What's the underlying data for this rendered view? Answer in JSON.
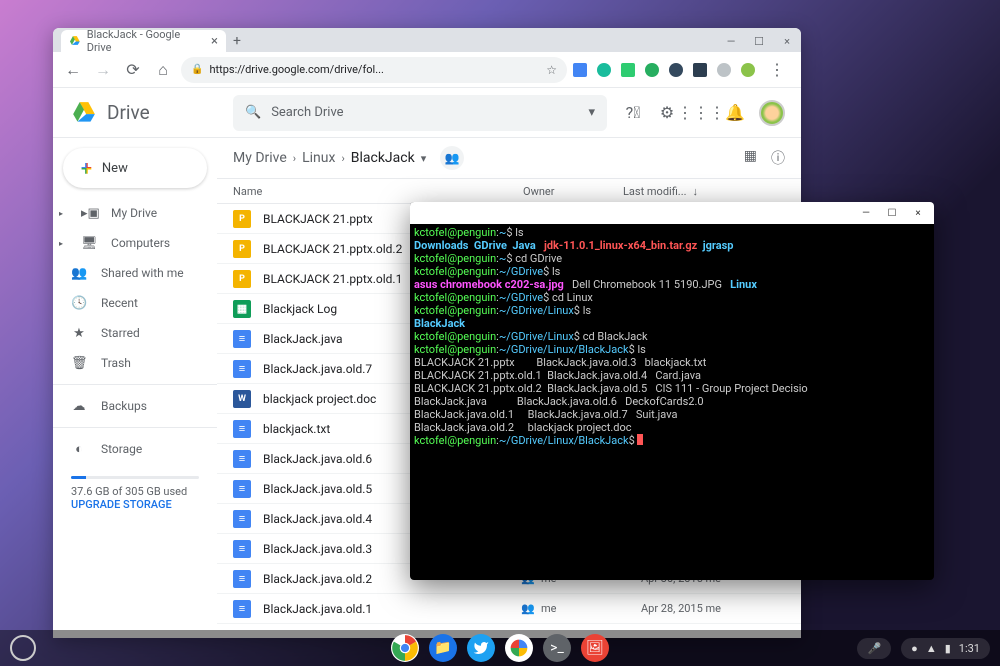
{
  "browser": {
    "tab_title": "BlackJack - Google Drive",
    "url": "https://drive.google.com/drive/fol...",
    "new_tab": "+"
  },
  "drive": {
    "app_name": "Drive",
    "search_placeholder": "Search Drive",
    "new_button": "New",
    "sidebar": [
      {
        "label": "My Drive",
        "icon": "▸▣",
        "exp": true
      },
      {
        "label": "Computers",
        "icon": "🖥",
        "exp": true
      },
      {
        "label": "Shared with me",
        "icon": "👥"
      },
      {
        "label": "Recent",
        "icon": "🕓"
      },
      {
        "label": "Starred",
        "icon": "★"
      },
      {
        "label": "Trash",
        "icon": "🗑"
      }
    ],
    "backups_label": "Backups",
    "storage_label": "Storage",
    "storage_used": "37.6 GB of 305 GB used",
    "upgrade": "UPGRADE STORAGE",
    "breadcrumb": [
      "My Drive",
      "Linux",
      "BlackJack"
    ],
    "columns": {
      "name": "Name",
      "owner": "Owner",
      "modified": "Last modifi..."
    },
    "files": [
      {
        "name": "BLACKJACK 21.pptx",
        "type": "slides",
        "shared": true
      },
      {
        "name": "BLACKJACK 21.pptx.old.2",
        "type": "slides",
        "shared": true
      },
      {
        "name": "BLACKJACK 21.pptx.old.1",
        "type": "slides",
        "shared": true
      },
      {
        "name": "Blackjack Log",
        "type": "sheets",
        "shared": true
      },
      {
        "name": "BlackJack.java",
        "type": "doc",
        "shared": true
      },
      {
        "name": "BlackJack.java.old.7",
        "type": "doc",
        "shared": true
      },
      {
        "name": "blackjack project.doc",
        "type": "word",
        "shared": true
      },
      {
        "name": "blackjack.txt",
        "type": "doc",
        "shared": true
      },
      {
        "name": "BlackJack.java.old.6",
        "type": "doc",
        "shared": true
      },
      {
        "name": "BlackJack.java.old.5",
        "type": "doc",
        "shared": true
      },
      {
        "name": "BlackJack.java.old.4",
        "type": "doc",
        "shared": true
      },
      {
        "name": "BlackJack.java.old.3",
        "type": "doc",
        "shared": true
      },
      {
        "name": "BlackJack.java.old.2",
        "type": "doc",
        "shared": true,
        "owner": "me",
        "modified": "Apr 30, 2015 me"
      },
      {
        "name": "BlackJack.java.old.1",
        "type": "doc",
        "shared": true,
        "owner": "me",
        "modified": "Apr 28, 2015 me"
      }
    ]
  },
  "terminal": {
    "lines": [
      [
        {
          "t": "kctofel@penguin",
          "c": "u"
        },
        {
          "t": ":",
          "c": "c"
        },
        {
          "t": "~",
          "c": "p"
        },
        {
          "t": "$ ls",
          "c": "c"
        }
      ],
      [
        {
          "t": "Downloads  GDrive  Java   ",
          "c": "dir"
        },
        {
          "t": "jdk-11.0.1_linux-x64_bin.tar.gz",
          "c": "exe"
        },
        {
          "t": "  ",
          "c": "c"
        },
        {
          "t": "jgrasp",
          "c": "dir"
        }
      ],
      [
        {
          "t": "kctofel@penguin",
          "c": "u"
        },
        {
          "t": ":",
          "c": "c"
        },
        {
          "t": "~",
          "c": "p"
        },
        {
          "t": "$ cd GDrive",
          "c": "c"
        }
      ],
      [
        {
          "t": "kctofel@penguin",
          "c": "u"
        },
        {
          "t": ":",
          "c": "c"
        },
        {
          "t": "~/GDrive",
          "c": "p"
        },
        {
          "t": "$ ls",
          "c": "c"
        }
      ],
      [
        {
          "t": "asus chromebook c202-sa.jpg",
          "c": "img"
        },
        {
          "t": "   Dell Chromebook 11 5190.JPG   ",
          "c": "c"
        },
        {
          "t": "Linux",
          "c": "dir"
        }
      ],
      [
        {
          "t": "kctofel@penguin",
          "c": "u"
        },
        {
          "t": ":",
          "c": "c"
        },
        {
          "t": "~/GDrive",
          "c": "p"
        },
        {
          "t": "$ cd Linux",
          "c": "c"
        }
      ],
      [
        {
          "t": "kctofel@penguin",
          "c": "u"
        },
        {
          "t": ":",
          "c": "c"
        },
        {
          "t": "~/GDrive/Linux",
          "c": "p"
        },
        {
          "t": "$ ls",
          "c": "c"
        }
      ],
      [
        {
          "t": "BlackJack",
          "c": "dir"
        }
      ],
      [
        {
          "t": "kctofel@penguin",
          "c": "u"
        },
        {
          "t": ":",
          "c": "c"
        },
        {
          "t": "~/GDrive/Linux",
          "c": "p"
        },
        {
          "t": "$ cd BlackJack",
          "c": "c"
        }
      ],
      [
        {
          "t": "kctofel@penguin",
          "c": "u"
        },
        {
          "t": ":",
          "c": "c"
        },
        {
          "t": "~/GDrive/Linux/BlackJack",
          "c": "p"
        },
        {
          "t": "$ ls",
          "c": "c"
        }
      ],
      [
        {
          "t": "BLACKJACK 21.pptx        BlackJack.java.old.3   blackjack.txt",
          "c": "c"
        }
      ],
      [
        {
          "t": "BLACKJACK 21.pptx.old.1  BlackJack.java.old.4   Card.java",
          "c": "c"
        }
      ],
      [
        {
          "t": "BLACKJACK 21.pptx.old.2  BlackJack.java.old.5   CIS 111 - Group Project Decisio",
          "c": "c"
        }
      ],
      [
        {
          "t": "BlackJack.java           BlackJack.java.old.6   DeckofCards2.0",
          "c": "c"
        }
      ],
      [
        {
          "t": "BlackJack.java.old.1     BlackJack.java.old.7   Suit.java",
          "c": "c"
        }
      ],
      [
        {
          "t": "BlackJack.java.old.2     blackjack project.doc",
          "c": "c"
        }
      ],
      [
        {
          "t": "kctofel@penguin",
          "c": "u"
        },
        {
          "t": ":",
          "c": "c"
        },
        {
          "t": "~/GDrive/Linux/BlackJack",
          "c": "p"
        },
        {
          "t": "$ ",
          "c": "c"
        },
        {
          "t": "",
          "c": "cursor"
        }
      ]
    ]
  },
  "shelf": {
    "time": "1:31",
    "apps": [
      {
        "name": "chrome",
        "bg": "#fff"
      },
      {
        "name": "files",
        "bg": "#1a73e8"
      },
      {
        "name": "twitter",
        "bg": "#1da1f2"
      },
      {
        "name": "photos",
        "bg": "#fff"
      },
      {
        "name": "terminal",
        "bg": "#5f6368"
      },
      {
        "name": "screenshot",
        "bg": "#ea4335"
      }
    ]
  }
}
